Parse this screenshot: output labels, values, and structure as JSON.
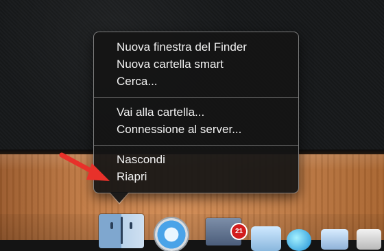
{
  "menu": {
    "items": [
      {
        "label": "Nuova finestra del Finder"
      },
      {
        "label": "Nuova cartella smart"
      },
      {
        "label": "Cerca..."
      },
      {
        "label": "Vai alla cartella..."
      },
      {
        "label": "Connessione al server..."
      },
      {
        "label": "Nascondi"
      },
      {
        "label": "Riapri"
      }
    ]
  },
  "dock": {
    "mail_badge": "21",
    "icons": [
      "finder-icon",
      "safari-icon",
      "mail-icon"
    ]
  },
  "colors": {
    "menu_bg": "#141414",
    "menu_text": "#f2f2f2",
    "annotation_arrow": "#e8312a",
    "badge": "#d21d1d"
  }
}
